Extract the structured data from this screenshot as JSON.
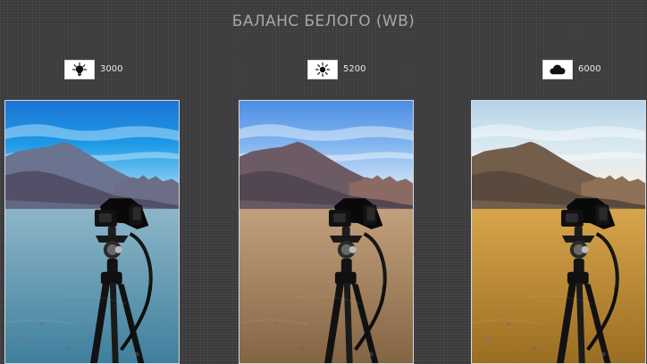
{
  "title": "БАЛАНС БЕЛОГО (WB)",
  "panels": [
    {
      "kelvin": "3000",
      "icon": "tungsten-bulb-icon",
      "sky_top": "#1d73d4",
      "sky_mid": "#1e9ae7",
      "sky_bottom": "#8fd1f3",
      "cloud": "#d7f2ff",
      "mountain_far": "#6a7390",
      "mountain_near": "#534f69",
      "ridge": "#6c6d86",
      "ground_top": "#8db6c8",
      "ground_bottom": "#3f7f9d",
      "haze": "rgba(165,225,255,0.18)"
    },
    {
      "kelvin": "5200",
      "icon": "sun-icon",
      "sky_top": "#4c8ee5",
      "sky_mid": "#82b5ef",
      "sky_bottom": "#d0e4f7",
      "cloud": "#ffffff",
      "mountain_far": "#6c5b65",
      "mountain_near": "#524652",
      "ridge": "#8a6a62",
      "ground_top": "#c3a07d",
      "ground_bottom": "#836443",
      "haze": "rgba(255,231,205,0.12)"
    },
    {
      "kelvin": "6000",
      "icon": "cloud-icon",
      "sky_top": "#b5d3e7",
      "sky_mid": "#d8e8f1",
      "sky_bottom": "#f5f0e8",
      "cloud": "#ffffff",
      "mountain_far": "#735d4b",
      "mountain_near": "#5a493d",
      "ridge": "#8f7157",
      "ground_top": "#d7a54b",
      "ground_bottom": "#9b6d22",
      "haze": "rgba(255,228,168,0.14)"
    }
  ]
}
